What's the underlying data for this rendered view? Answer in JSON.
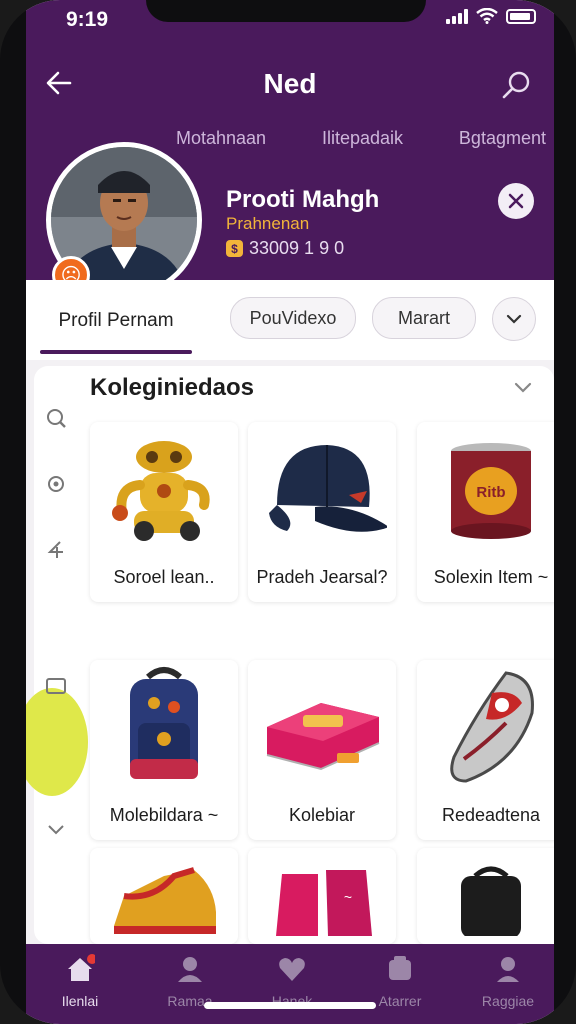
{
  "status": {
    "time": "9:19"
  },
  "header": {
    "title": "Ned",
    "subtabs": [
      "Motahnaan",
      "Ilitepadaik",
      "Bgtagment"
    ]
  },
  "profile": {
    "name": "Prooti Mahgh",
    "subtitle": "Prahnenan",
    "stat": "33009 1  9  0"
  },
  "tabs": {
    "active_label": "Profil Pernam",
    "pill_1": "PouVidexo",
    "pill_2": "Marart"
  },
  "section": {
    "title": "Koleginiedaos"
  },
  "items": [
    {
      "label": "Soroel lean..",
      "icon": "robot-toy"
    },
    {
      "label": "Pradeh Jearsal?",
      "icon": "cap"
    },
    {
      "label": "Solexin Item ~",
      "icon": "tin-can"
    },
    {
      "label": "Molebildara ~",
      "icon": "backpack"
    },
    {
      "label": "Kolebiar",
      "icon": "pencil-case"
    },
    {
      "label": "Redeadtena",
      "icon": "slipper"
    },
    {
      "label": "",
      "icon": "sneaker"
    },
    {
      "label": "",
      "icon": "socks"
    },
    {
      "label": "",
      "icon": "bag"
    }
  ],
  "bottom_nav": [
    {
      "label": "Ilenlai",
      "icon": "home-icon"
    },
    {
      "label": "Ramaa",
      "icon": "user-icon"
    },
    {
      "label": "Hanek",
      "icon": "heart-icon"
    },
    {
      "label": "Atarrer",
      "icon": "badge-icon"
    },
    {
      "label": "Raggiae",
      "icon": "profile-icon"
    }
  ],
  "colors": {
    "brand_purple": "#4a1a5c",
    "accent_orange": "#f06b1d",
    "accent_gold": "#f2b43a"
  }
}
